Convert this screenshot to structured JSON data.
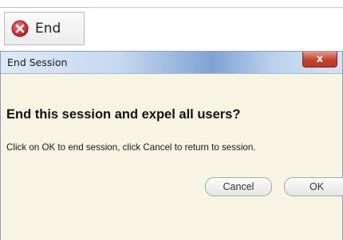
{
  "toolbar": {
    "end_button": {
      "label": "End",
      "icon": "red-circle-x-icon"
    }
  },
  "dialog": {
    "title": "End Session",
    "close_glyph": "x",
    "heading": "End this session and expel all users?",
    "message": "Click on OK to end session, click Cancel to return to session.",
    "buttons": {
      "cancel": "Cancel",
      "ok": "OK"
    }
  },
  "colors": {
    "dialog_background": "#f8f4e3",
    "close_button": "#c4412a",
    "end_icon": "#d7333b"
  }
}
